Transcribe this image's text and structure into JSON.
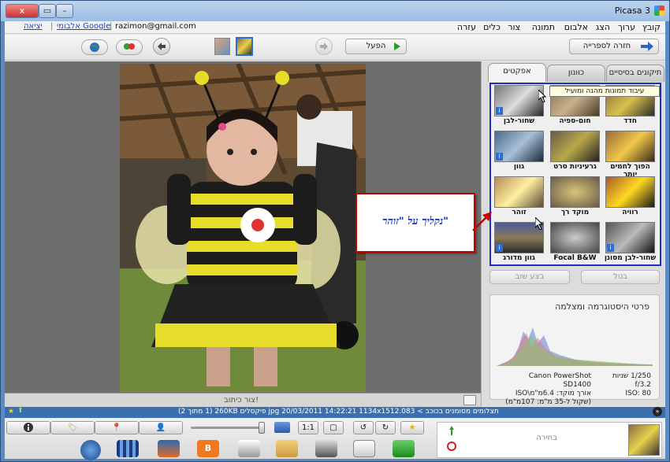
{
  "window": {
    "title": "Picasa 3",
    "close_label": "x",
    "max_label": "▭",
    "min_label": "–"
  },
  "menubar": {
    "items": [
      "קובץ",
      "ערוך",
      "הצג",
      "אלבום",
      "תמונה",
      "צור",
      "כלים",
      "עזרה"
    ],
    "email": "razimon@gmail.com",
    "web_albums_link": "אלבומי Google",
    "separator": "|",
    "exit_link": "יציאה"
  },
  "toolbar": {
    "back_to_library": "חזרה לספרייה",
    "play_label": "הפעל"
  },
  "viewer": {
    "caption_placeholder": "צור כיתוב!"
  },
  "panel": {
    "tabs": [
      "תיקונים בסיסיים",
      "כוונון",
      "אפקטים"
    ],
    "tooltip": "עיבוד תמונות מהנה ומועיל",
    "effects": [
      "חדד",
      "חום-ספיה",
      "שחור-לבן",
      "הפוך לחמים יותר",
      "גרעיניות סרט",
      "גוון",
      "רוויה",
      "מוקד רך",
      "זוהר",
      "שחור-לבן מסונן",
      "Focal B&W",
      "גוון מדורג"
    ],
    "cancel_label": "בטל",
    "redo_label": "בצע שוב",
    "histogram_title": "פרטי היסטוגרמה ומצלמה",
    "camera": "Canon PowerShot SD1400",
    "exposure": "1/250 שניות",
    "aperture": "f/3.2",
    "iso": "ISO: 80",
    "focal": "אורך מוקד: 6.4מ\"מ\\ISO",
    "equiv": "(שקול ל-35 מ\"מ: 107מ\"מ)"
  },
  "callout": {
    "text": "נקליך על \"זוהר\""
  },
  "statusbar": {
    "text": "תצלומים מסומנים בכוכב > 083.jpg     20/03/2011   14:22:21     1134x1512 פיקסלים   260KB     (1 מתוך 2)"
  },
  "tray": {
    "selection_label": "בחירה"
  },
  "colors": {
    "accent_blue": "#1e2fc2",
    "callout_border": "#b00000",
    "statusbar": "#3b6fae"
  }
}
